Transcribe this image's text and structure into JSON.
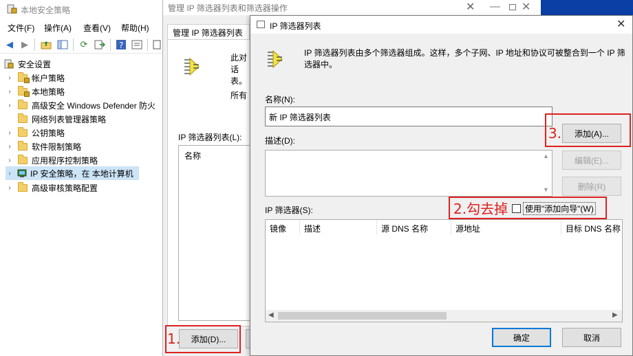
{
  "main_window": {
    "title": "本地安全策略",
    "menu": [
      "文件(F)",
      "操作(A)",
      "查看(V)",
      "帮助(H)"
    ],
    "tree": {
      "root": "安全设置",
      "items": [
        {
          "label": "帐户策略"
        },
        {
          "label": "本地策略"
        },
        {
          "label": "高级安全 Windows Defender 防火"
        },
        {
          "label": "网络列表管理器策略"
        },
        {
          "label": "公钥策略"
        },
        {
          "label": "软件限制策略"
        },
        {
          "label": "应用程序控制策略"
        },
        {
          "label": "IP 安全策略，在 本地计算机"
        },
        {
          "label": "高级审核策略配置"
        }
      ]
    }
  },
  "manager_dialog": {
    "title": "管理 IP 筛选器列表和筛选器操作",
    "tab": "管理 IP 筛选器列表",
    "desc_line1": "此对话",
    "desc_line2": "表。",
    "desc_line3": "所有",
    "list_label": "IP 筛选器列表(L):",
    "list_header": "名称",
    "add_button": "添加(D)..."
  },
  "filter_list_dialog": {
    "title": "IP 筛选器列表",
    "intro": "IP 筛选器列表由多个筛选器组成。这样，多个子网、IP 地址和协议可被整合到一个 IP 筛选器中。",
    "name_label": "名称(N):",
    "name_value": "新 IP 筛选器列表",
    "desc_label": "描述(D):",
    "desc_value": "",
    "filters_label": "IP 筛选器(S):",
    "use_wizard_label": "使用\"添加向导\"(W)",
    "use_wizard_checked": false,
    "columns": [
      "镜像",
      "描述",
      "源 DNS 名称",
      "源地址",
      "目标 DNS 名称"
    ],
    "rows": [],
    "buttons": {
      "add": "添加(A)...",
      "edit": "编辑(E)...",
      "delete": "删除(R)",
      "ok": "确定",
      "cancel": "取消"
    }
  },
  "annotations": {
    "step1": "1.",
    "step2": "2.勾去掉",
    "step3": "3.",
    "color": "#e02020"
  },
  "colors": {
    "selection": "#cce4f7",
    "accent_blue": "#0078d7",
    "desktop_blue": "#0b3fa6"
  }
}
